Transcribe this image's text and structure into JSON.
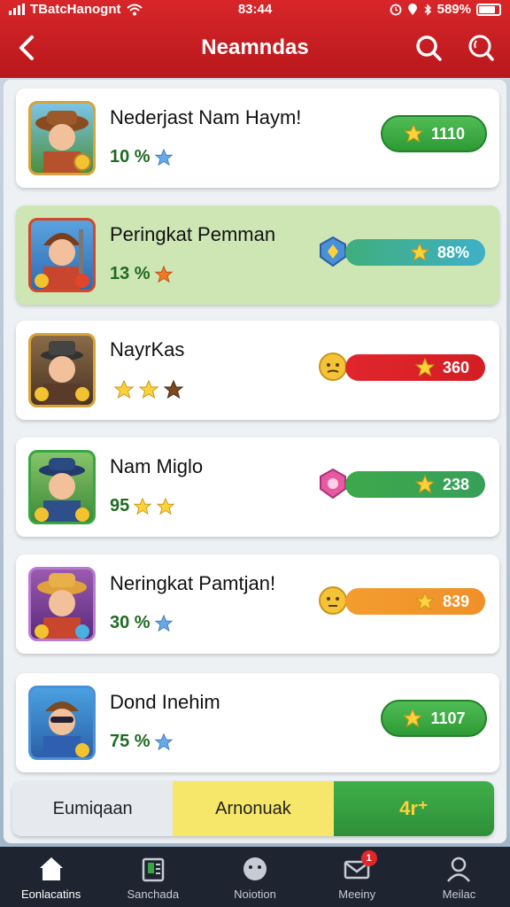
{
  "status": {
    "carrier": "TBatcHanognt",
    "time": "83:44",
    "battery": "589%"
  },
  "header": {
    "title": "Neamndas"
  },
  "players": [
    {
      "name": "Nederjast Nam Haym!",
      "stat": "10 %",
      "score": "1110",
      "kind": "pill",
      "bar_color": "#3aa542",
      "stars": [
        "blue"
      ]
    },
    {
      "name": "Peringkat Pemman",
      "stat": "13 %",
      "score": "88%",
      "kind": "bar",
      "bar_color": "#3fb0a8",
      "stars": [
        "orange"
      ],
      "highlight": true
    },
    {
      "name": "NayrKas",
      "stat": "",
      "score": "360",
      "kind": "bar",
      "bar_color": "#e0262c",
      "stars": [
        "gold",
        "gold",
        "brown"
      ]
    },
    {
      "name": "Nam Miglo",
      "stat": "95",
      "score": "238",
      "kind": "bar",
      "bar_color": "#3da84a",
      "stars": [
        "gold",
        "gold"
      ]
    },
    {
      "name": "Neringkat Pamtjan!",
      "stat": "30 %",
      "score": "839",
      "kind": "bar",
      "bar_color": "#f0962e",
      "stars": [
        "blue"
      ]
    },
    {
      "name": "Dond Inehim",
      "stat": "75 %",
      "score": "1107",
      "kind": "pill",
      "bar_color": "#3aa542",
      "stars": [
        "blue"
      ]
    }
  ],
  "segments": {
    "left": "Eumiqaan",
    "middle": "Arnonuak",
    "right": "4r⁺"
  },
  "bottom_nav": [
    {
      "label": "Eonlacatins",
      "icon": "home-icon"
    },
    {
      "label": "Sanchada",
      "icon": "book-icon"
    },
    {
      "label": "Noiotion",
      "icon": "face-icon"
    },
    {
      "label": "Meeiny",
      "icon": "mail-icon",
      "badge": "1"
    },
    {
      "label": "Meilac",
      "icon": "profile-icon"
    }
  ],
  "colors": {
    "header": "#c81e22",
    "accent_green": "#2e9a35",
    "seg_yellow": "#f6e66a",
    "nav_bg": "#1e2430"
  }
}
